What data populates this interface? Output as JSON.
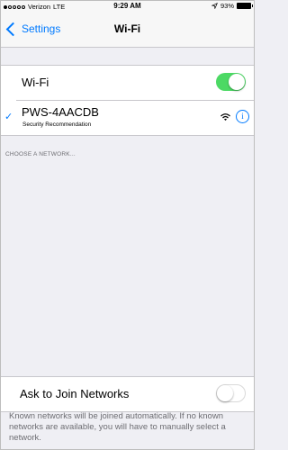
{
  "status_bar": {
    "carrier": "Verizon",
    "network": "LTE",
    "time": "9:29 AM",
    "battery": "93%"
  },
  "nav": {
    "back_label": "Settings",
    "title": "Wi-Fi"
  },
  "wifi": {
    "label": "Wi-Fi",
    "enabled": true
  },
  "connected_network": {
    "name": "PWS-4AACDB",
    "subtitle": "Security Recommendation",
    "info": "i"
  },
  "section": {
    "choose_network": "CHOOSE A NETWORK..."
  },
  "ask_to_join": {
    "label": "Ask to Join Networks",
    "enabled": false,
    "description": "Known networks will be joined automatically. If no known networks are available, you will have to manually select a network."
  },
  "colors": {
    "accent": "#007aff",
    "switch_on": "#4cd964",
    "background": "#efeff4"
  }
}
